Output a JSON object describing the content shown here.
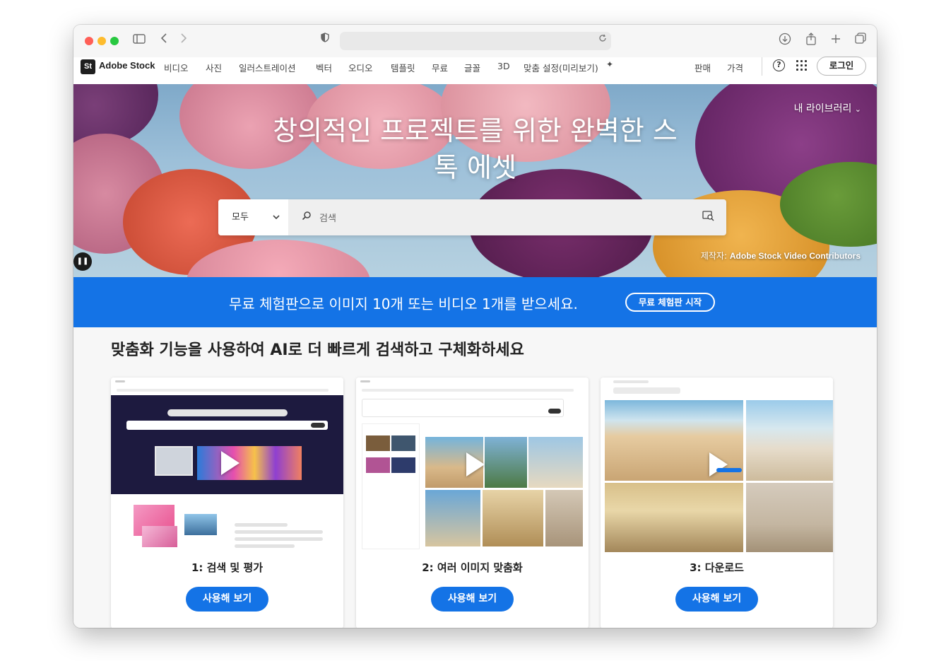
{
  "browser": {
    "icons": {
      "sidebar": "sidebar-icon",
      "back": "chevron-left-icon",
      "forward": "chevron-right-icon",
      "shield": "shield-icon",
      "reload": "reload-icon",
      "download": "download-icon",
      "share": "share-icon",
      "new_tab": "plus-icon",
      "tabs": "tabs-icon"
    },
    "address_value": ""
  },
  "nav": {
    "logo_mark": "St",
    "logo_text": "Adobe Stock",
    "items": [
      "비디오",
      "사진",
      "일러스트레이션",
      "벡터",
      "오디오",
      "템플릿",
      "무료",
      "글꼴",
      "3D",
      "맞춤 설정(미리보기)"
    ],
    "sell": "판매",
    "pricing": "가격",
    "help_symbol": "?",
    "login": "로그인"
  },
  "hero": {
    "title_line1": "창의적인 프로젝트를 위한 완벽한 스",
    "title_line2": "톡 에셋",
    "my_library": "내 라이브러리",
    "search": {
      "category": "모두",
      "placeholder": "검색"
    },
    "credit_prefix": "제작자: ",
    "credit_name": "Adobe Stock Video Contributors"
  },
  "promo": {
    "text": "무료 체험판으로 이미지 10개 또는 비디오 1개를 받으세요.",
    "button": "무료 체험판 시작"
  },
  "section": {
    "title": "맞춤화 기능을 사용하여 AI로 더 빠르게 검색하고 구체화하세요",
    "cards": [
      {
        "label": "1: 검색 및 평가",
        "button": "사용해 보기"
      },
      {
        "label": "2: 여러 이미지 맞춤화",
        "button": "사용해 보기"
      },
      {
        "label": "3: 다운로드",
        "button": "사용해 보기"
      }
    ]
  },
  "colors": {
    "brand_blue": "#1473e6",
    "hero_sky": "#8fb6d3"
  }
}
